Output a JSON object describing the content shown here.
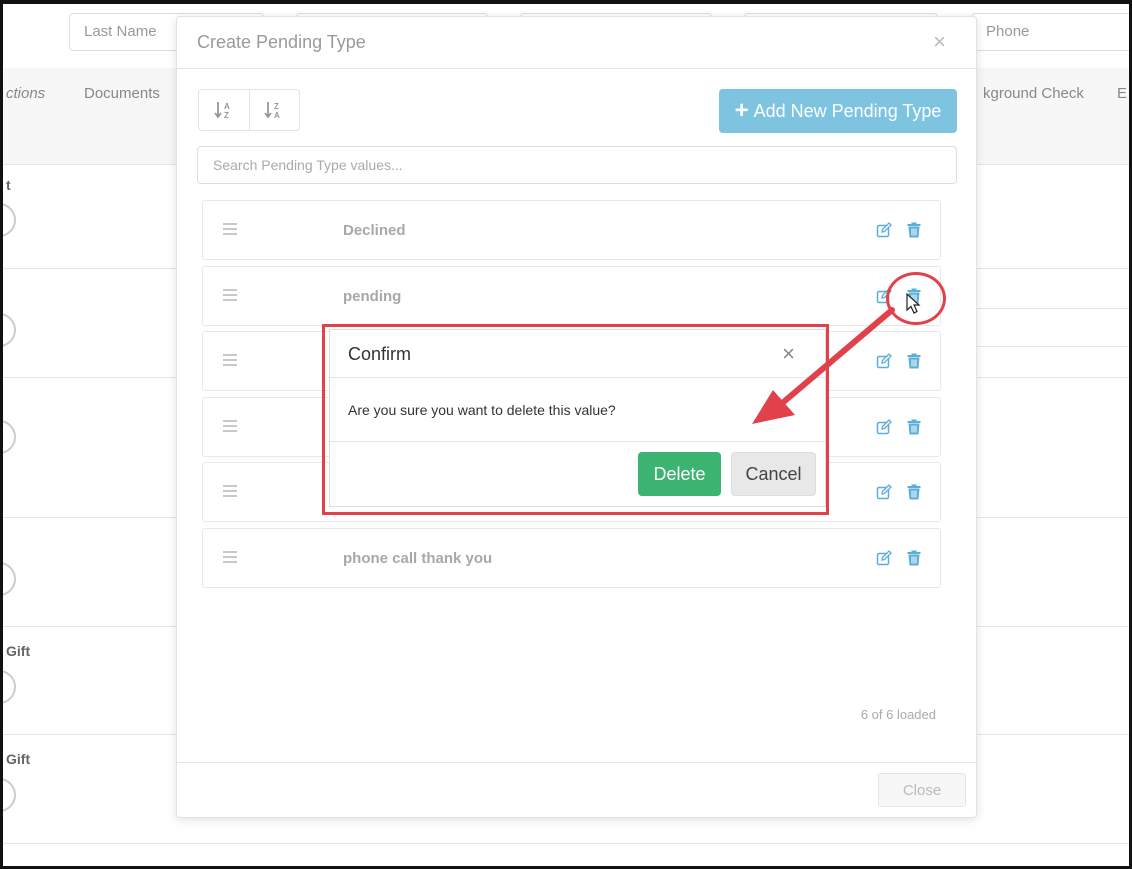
{
  "background": {
    "fields": {
      "last_name": "Last Name",
      "phone": "Phone"
    },
    "tabs": {
      "actions": "ctions",
      "documents": "Documents",
      "background_check": "kground Check",
      "extra": "E"
    },
    "rows": {
      "row1_frag": "t",
      "row2_frag": "Gift",
      "row3_frag": "Gift"
    }
  },
  "modal": {
    "title": "Create Pending Type",
    "close_icon": "close-icon",
    "sort_az_icon": "sort-a-z-icon",
    "sort_za_icon": "sort-z-a-icon",
    "add_button": {
      "icon": "+",
      "label": "Add New Pending Type"
    },
    "search_placeholder": "Search Pending Type values...",
    "items": [
      {
        "label": "Declined"
      },
      {
        "label": "pending"
      },
      {
        "label": ""
      },
      {
        "label": ""
      },
      {
        "label": ""
      },
      {
        "label": "phone call thank you"
      }
    ],
    "loaded_text": "6 of 6 loaded",
    "close_button": "Close"
  },
  "confirm": {
    "title": "Confirm",
    "close_glyph": "×",
    "message": "Are you sure you want to delete this value?",
    "delete_label": "Delete",
    "cancel_label": "Cancel"
  },
  "colors": {
    "accent": "#7ec3e0",
    "icon": "#5aaed8",
    "delete_green": "#3cb371",
    "annotation_red": "#e0414a"
  }
}
